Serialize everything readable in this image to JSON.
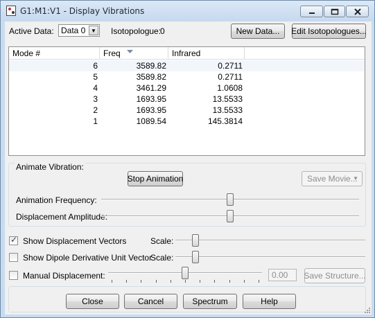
{
  "window": {
    "title": "G1:M1:V1 - Display Vibrations"
  },
  "top": {
    "active_data_label": "Active Data:",
    "active_data_value": "Data 0",
    "isotopologue_label": "Isotopologue:",
    "isotopologue_value": "0",
    "new_data_button": "New Data...",
    "edit_isotopologues_button": "Edit Isotopologues..."
  },
  "table": {
    "columns": [
      "Mode #",
      "Freq",
      "Infrared"
    ],
    "rows": [
      {
        "mode": "6",
        "freq": "3589.82",
        "infrared": "0.2711"
      },
      {
        "mode": "5",
        "freq": "3589.82",
        "infrared": "0.2711"
      },
      {
        "mode": "4",
        "freq": "3461.29",
        "infrared": "1.0608"
      },
      {
        "mode": "3",
        "freq": "1693.95",
        "infrared": "13.5533"
      },
      {
        "mode": "2",
        "freq": "1693.95",
        "infrared": "13.5533"
      },
      {
        "mode": "1",
        "freq": "1089.54",
        "infrared": "145.3814"
      }
    ]
  },
  "animate": {
    "group_label": "Animate Vibration:",
    "stop_button": "Stop Animation",
    "save_movie_button": "Save Movie...",
    "frequency_label": "Animation Frequency:",
    "frequency_level": 0.5,
    "amplitude_label": "Displacement Amplitude:",
    "amplitude_level": 0.5
  },
  "options": {
    "show_displacement_vectors": {
      "label": "Show Displacement Vectors",
      "checked": true,
      "scale_label": "Scale:",
      "scale_level": 0.09
    },
    "show_dipole_derivative": {
      "label": "Show Dipole Derivative Unit Vector",
      "checked": false,
      "scale_label": "Scale:",
      "scale_level": 0.09
    },
    "manual_displacement": {
      "label": "Manual Displacement:",
      "checked": false,
      "value": "0.00",
      "level": 0.5,
      "save_structure_button": "Save Structure..."
    }
  },
  "bottom_buttons": {
    "close": "Close",
    "cancel": "Cancel",
    "spectrum": "Spectrum",
    "help": "Help"
  },
  "colors": {
    "title_bar": "#c6d9ee",
    "dialog_bg": "#f0f0f0",
    "disabled_text": "#8d8d8d"
  },
  "icons": [
    "app-icon",
    "minimize-icon",
    "maximize-icon",
    "close-icon",
    "dropdown-arrow-icon",
    "sort-descending-icon",
    "checkmark-icon",
    "resize-grip-icon"
  ]
}
